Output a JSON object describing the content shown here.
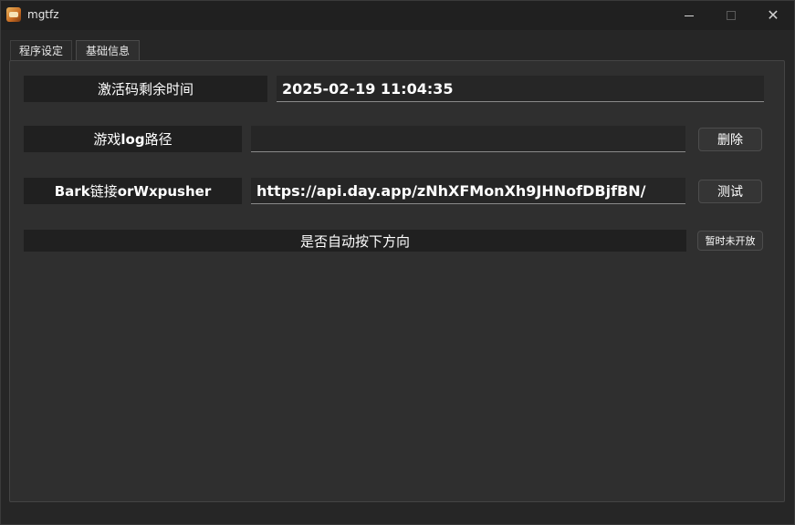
{
  "window": {
    "title": "mgtfz",
    "controls": {
      "minimize": "─",
      "maximize": "☐",
      "close": "✕"
    }
  },
  "tabs": [
    {
      "label": "程序设定",
      "active": false
    },
    {
      "label": "基础信息",
      "active": true
    }
  ],
  "activation": {
    "label": "激活码剩余时间",
    "value": "2025-02-19 11:04:35"
  },
  "game_log": {
    "label_prefix": "游戏",
    "label_bold": "log",
    "label_suffix": "路径",
    "value": "",
    "button": "删除"
  },
  "bark": {
    "label_bold1": "Bark",
    "label_mid": "链接",
    "label_bold2": "orWxpusher",
    "value": "https://api.day.app/zNhXFMonXh9JHNofDBjfBN/",
    "button": "测试"
  },
  "auto_press": {
    "label": "是否自动按下方向",
    "button": "暂时未开放"
  },
  "colors": {
    "background": "#262626",
    "panel": "#2f2f2f",
    "label_bg": "#202020"
  }
}
